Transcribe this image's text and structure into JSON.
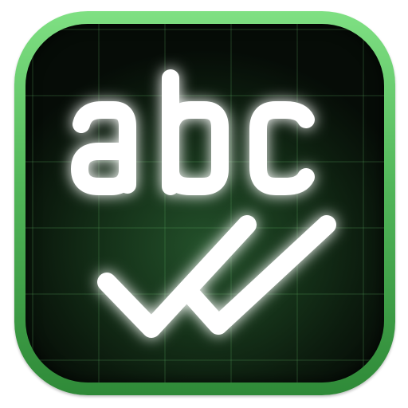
{
  "app_icon": {
    "lettering": "abc",
    "accent_color": "#5cc462",
    "glyph_color": "#ffffff",
    "glow_color": "#4cff5a",
    "icon_names": [
      "abc-letters-icon",
      "double-check-icon"
    ]
  }
}
